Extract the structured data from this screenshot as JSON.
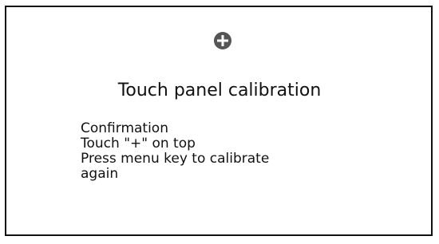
{
  "screen": {
    "title": "Touch panel calibration",
    "target_icon": "plus-circle-icon",
    "message_lines": [
      "Confirmation",
      "Touch \"+\" on top",
      "Press menu key to calibrate",
      "again"
    ]
  },
  "colors": {
    "text": "#111111",
    "border": "#111111",
    "background": "#ffffff",
    "target_fill": "#555555",
    "target_cross": "#ffffff"
  }
}
